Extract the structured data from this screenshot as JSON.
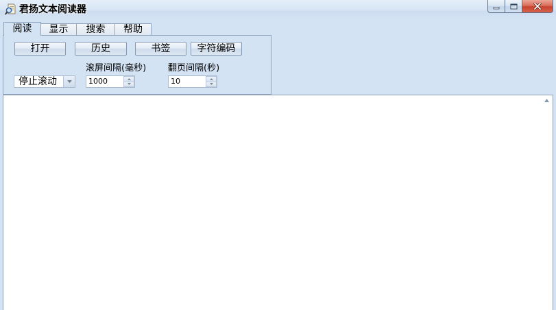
{
  "window": {
    "title": "君扬文本阅读器"
  },
  "tabs": [
    {
      "label": "阅读",
      "selected": true
    },
    {
      "label": "显示",
      "selected": false
    },
    {
      "label": "搜索",
      "selected": false
    },
    {
      "label": "帮助",
      "selected": false
    }
  ],
  "read_panel": {
    "buttons": [
      {
        "label": "打开"
      },
      {
        "label": "历史"
      },
      {
        "label": "书签"
      },
      {
        "label": "字符编码"
      }
    ],
    "scroll_mode": {
      "selected": "停止滚动"
    },
    "scroll_interval": {
      "label": "滚屏间隔(毫秒)",
      "value": "1000"
    },
    "page_interval": {
      "label": "翻页间隔(秒)",
      "value": "10"
    }
  },
  "icons": {
    "app": "reader-app-icon",
    "minimize": "minimize-icon",
    "maximize": "maximize-icon",
    "close": "close-icon",
    "dropdown": "chevron-down-icon",
    "spin_up": "spin-up-icon",
    "spin_down": "spin-down-icon",
    "scroll_up": "scroll-up-arrow-icon"
  },
  "colors": {
    "window_bg": "#d4e3f4",
    "panel_border": "#8ea4be",
    "close_button": "#c8442f",
    "text_area_bg": "#ffffff",
    "text_area_border": "#8f9db0"
  }
}
